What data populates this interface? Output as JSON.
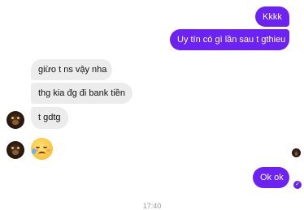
{
  "messages": {
    "out_1": "Kkkk",
    "out_2": "Uy tín có gì lần sau t gthieu",
    "in_1": "giừo t ns vậy nha",
    "in_2": "thg kia đg đi bank tiền",
    "in_3": "t gdtg",
    "in_4_emoji": "face-holding-back-tears",
    "out_3": "Ok ok"
  },
  "timestamp": "17:40",
  "read_receipt": "✓",
  "colors": {
    "outgoing_bubble": "#6b22f2",
    "incoming_bubble": "#ececec"
  }
}
